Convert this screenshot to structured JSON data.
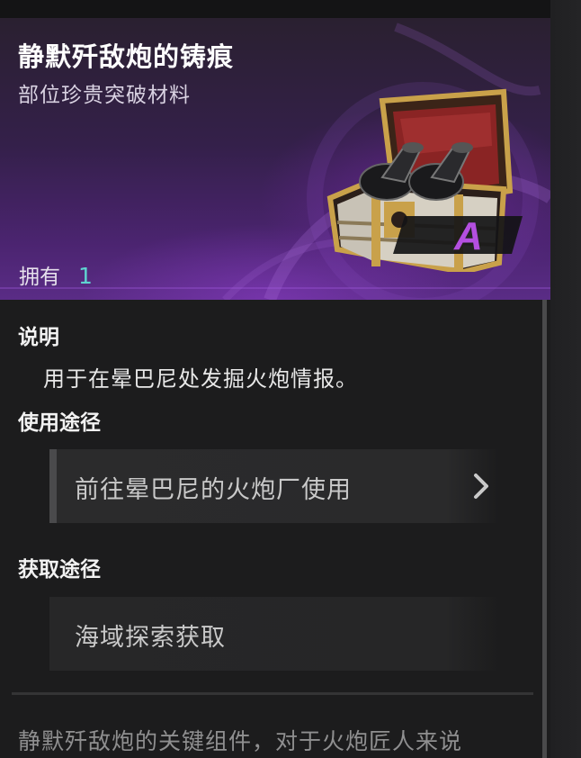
{
  "item": {
    "name": "静默歼敌炮的铸痕",
    "category": "部位珍贵突破材料",
    "owned_label": "拥有",
    "owned_count": "1",
    "rarity": "A",
    "icon": "treasure-chest-with-cannon-shells-icon"
  },
  "description": {
    "title": "说明",
    "text": "用于在晕巴尼处发掘火炮情报。"
  },
  "usage": {
    "title": "使用途径",
    "button_label": "前往晕巴尼的火炮厂使用"
  },
  "acquisition": {
    "title": "获取途径",
    "source": "海域探索获取"
  },
  "lore": {
    "text": "静默歼敌炮的关键组件，对于火炮匠人来说"
  },
  "colors": {
    "accent_count": "#5fd4d1",
    "rarity": "#b44fe0",
    "header_purple": "#5a2c86"
  }
}
